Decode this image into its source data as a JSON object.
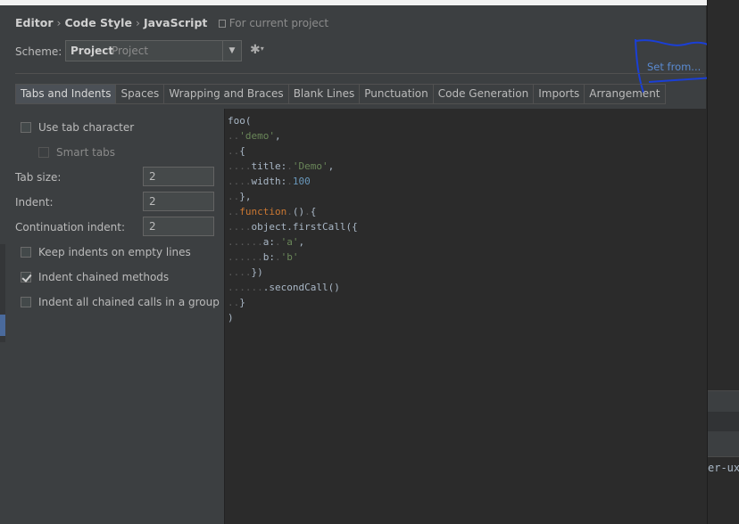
{
  "breadcrumb": {
    "part1": "Editor",
    "part2": "Code Style",
    "part3": "JavaScript",
    "sep": "›",
    "scope": "For current project"
  },
  "scheme": {
    "label": "Scheme:",
    "name": "Project",
    "subtitle": "Project"
  },
  "set_from": "Set from...",
  "tabs": [
    "Tabs and Indents",
    "Spaces",
    "Wrapping and Braces",
    "Blank Lines",
    "Punctuation",
    "Code Generation",
    "Imports",
    "Arrangement"
  ],
  "options": {
    "use_tab_character": {
      "label": "Use tab character",
      "checked": false
    },
    "smart_tabs": {
      "label": "Smart tabs",
      "checked": false,
      "enabled": false
    },
    "tab_size": {
      "label": "Tab size:",
      "value": "2"
    },
    "indent": {
      "label": "Indent:",
      "value": "2"
    },
    "continuation_indent": {
      "label": "Continuation indent:",
      "value": "2"
    },
    "keep_indents": {
      "label": "Keep indents on empty lines",
      "checked": false
    },
    "indent_chained": {
      "label": "Indent chained methods",
      "checked": true
    },
    "indent_all_chained": {
      "label": "Indent all chained calls in a group",
      "checked": false
    }
  },
  "code_lines": [
    [
      [
        "",
        "foo("
      ]
    ],
    [
      [
        "ws",
        ".."
      ],
      [
        "str",
        "'demo'"
      ],
      [
        "",
        ","
      ]
    ],
    [
      [
        "ws",
        ".."
      ],
      [
        "",
        "{"
      ]
    ],
    [
      [
        "ws",
        "...."
      ],
      [
        "",
        "title:"
      ],
      [
        "ws",
        "."
      ],
      [
        "str",
        "'Demo'"
      ],
      [
        "",
        ","
      ]
    ],
    [
      [
        "ws",
        "...."
      ],
      [
        "",
        "width:"
      ],
      [
        "ws",
        "."
      ],
      [
        "num",
        "100"
      ]
    ],
    [
      [
        "ws",
        ".."
      ],
      [
        "",
        "},"
      ]
    ],
    [
      [
        "ws",
        ".."
      ],
      [
        "kw",
        "function"
      ],
      [
        "ws",
        "."
      ],
      [
        "",
        "()"
      ],
      [
        "ws",
        "."
      ],
      [
        "",
        "{"
      ]
    ],
    [
      [
        "ws",
        "...."
      ],
      [
        "",
        "object.firstCall({"
      ]
    ],
    [
      [
        "ws",
        "......"
      ],
      [
        "",
        "a:"
      ],
      [
        "ws",
        "."
      ],
      [
        "str",
        "'a'"
      ],
      [
        "",
        ","
      ]
    ],
    [
      [
        "ws",
        "......"
      ],
      [
        "",
        "b:"
      ],
      [
        "ws",
        "."
      ],
      [
        "str",
        "'b'"
      ]
    ],
    [
      [
        "ws",
        "...."
      ],
      [
        "",
        "})"
      ]
    ],
    [
      [
        "ws",
        "......"
      ],
      [
        "",
        ".secondCall()"
      ]
    ],
    [
      [
        "ws",
        ".."
      ],
      [
        "",
        "}"
      ]
    ],
    [
      [
        "",
        ")"
      ]
    ]
  ],
  "side_text": "er-ux",
  "colors": {
    "background": "#3c3f41",
    "editor_bg": "#2b2b2b",
    "string": "#6a8759",
    "number": "#6897bb",
    "keyword": "#cc7832",
    "link": "#5a8ad0",
    "annotation": "#1a3fd6"
  },
  "icons": {
    "gear": "gear-icon",
    "dropdown": "chevron-down-icon",
    "project_scope": "project-icon"
  }
}
